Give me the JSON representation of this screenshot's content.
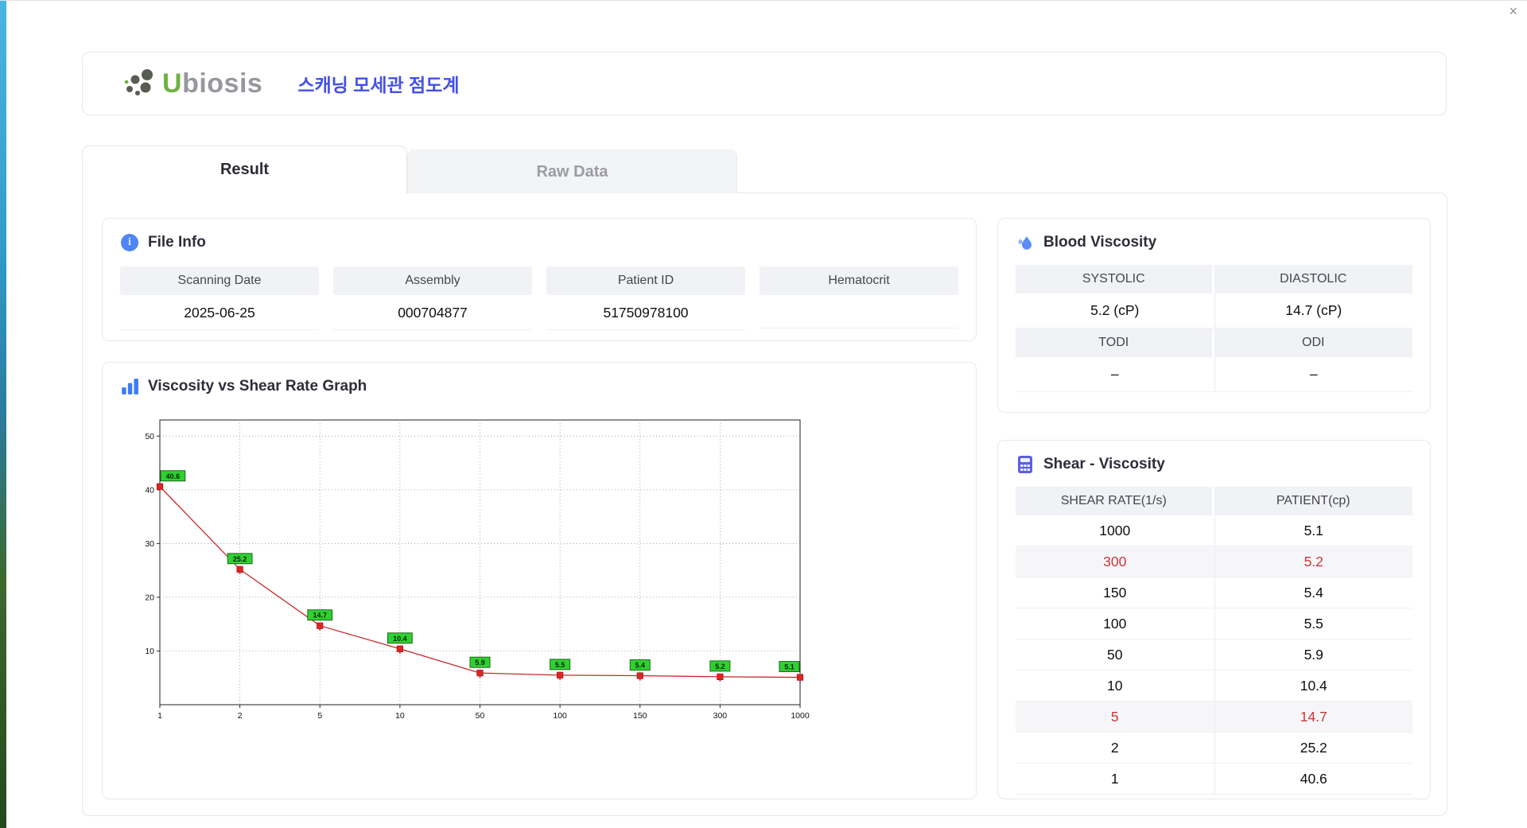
{
  "window": {
    "close_label": "×"
  },
  "header": {
    "logo_u": "U",
    "logo_rest": "biosis",
    "title": "스캐닝 모세관 점도계"
  },
  "tabs": [
    {
      "label": "Result",
      "active": true
    },
    {
      "label": "Raw Data",
      "active": false
    }
  ],
  "file_info": {
    "title": "File Info",
    "fields": [
      {
        "label": "Scanning Date",
        "value": "2025-06-25"
      },
      {
        "label": "Assembly",
        "value": "000704877"
      },
      {
        "label": "Patient ID",
        "value": "51750978100"
      },
      {
        "label": "Hematocrit",
        "value": ""
      }
    ]
  },
  "graph": {
    "title": "Viscosity vs Shear Rate Graph"
  },
  "chart_data": {
    "type": "line",
    "title": "Viscosity vs Shear Rate Graph",
    "x": [
      1,
      2,
      5,
      10,
      50,
      100,
      150,
      300,
      1000
    ],
    "values": [
      40.6,
      25.2,
      14.7,
      10.4,
      5.9,
      5.5,
      5.4,
      5.2,
      5.1
    ],
    "xlabel": "",
    "ylabel": "",
    "ylim": [
      0,
      53
    ],
    "yticks": [
      10,
      20,
      30,
      40,
      50
    ],
    "x_axis": "equally-spaced category ticks (log-style labels)",
    "grid": true,
    "legend": "none",
    "line_color": "#c62a2a",
    "marker_color": "#e02424",
    "marker_edge": "#8f1212",
    "label_bg": "#2fd12f",
    "label_border": "#135c13"
  },
  "blood_viscosity": {
    "title": "Blood Viscosity",
    "rows": [
      {
        "label1": "SYSTOLIC",
        "label2": "DIASTOLIC",
        "value1": "5.2 (cP)",
        "value2": "14.7 (cP)"
      },
      {
        "label1": "TODI",
        "label2": "ODI",
        "value1": "–",
        "value2": "–"
      }
    ]
  },
  "shear_viscosity": {
    "title": "Shear - Viscosity",
    "columns": [
      "SHEAR RATE(1/s)",
      "PATIENT(cp)"
    ],
    "rows": [
      {
        "rate": "1000",
        "patient": "5.1",
        "highlight": false
      },
      {
        "rate": "300",
        "patient": "5.2",
        "highlight": true
      },
      {
        "rate": "150",
        "patient": "5.4",
        "highlight": false
      },
      {
        "rate": "100",
        "patient": "5.5",
        "highlight": false
      },
      {
        "rate": "50",
        "patient": "5.9",
        "highlight": false
      },
      {
        "rate": "10",
        "patient": "10.4",
        "highlight": false
      },
      {
        "rate": "5",
        "patient": "14.7",
        "highlight": true
      },
      {
        "rate": "2",
        "patient": "25.2",
        "highlight": false
      },
      {
        "rate": "1",
        "patient": "40.6",
        "highlight": false
      }
    ]
  }
}
